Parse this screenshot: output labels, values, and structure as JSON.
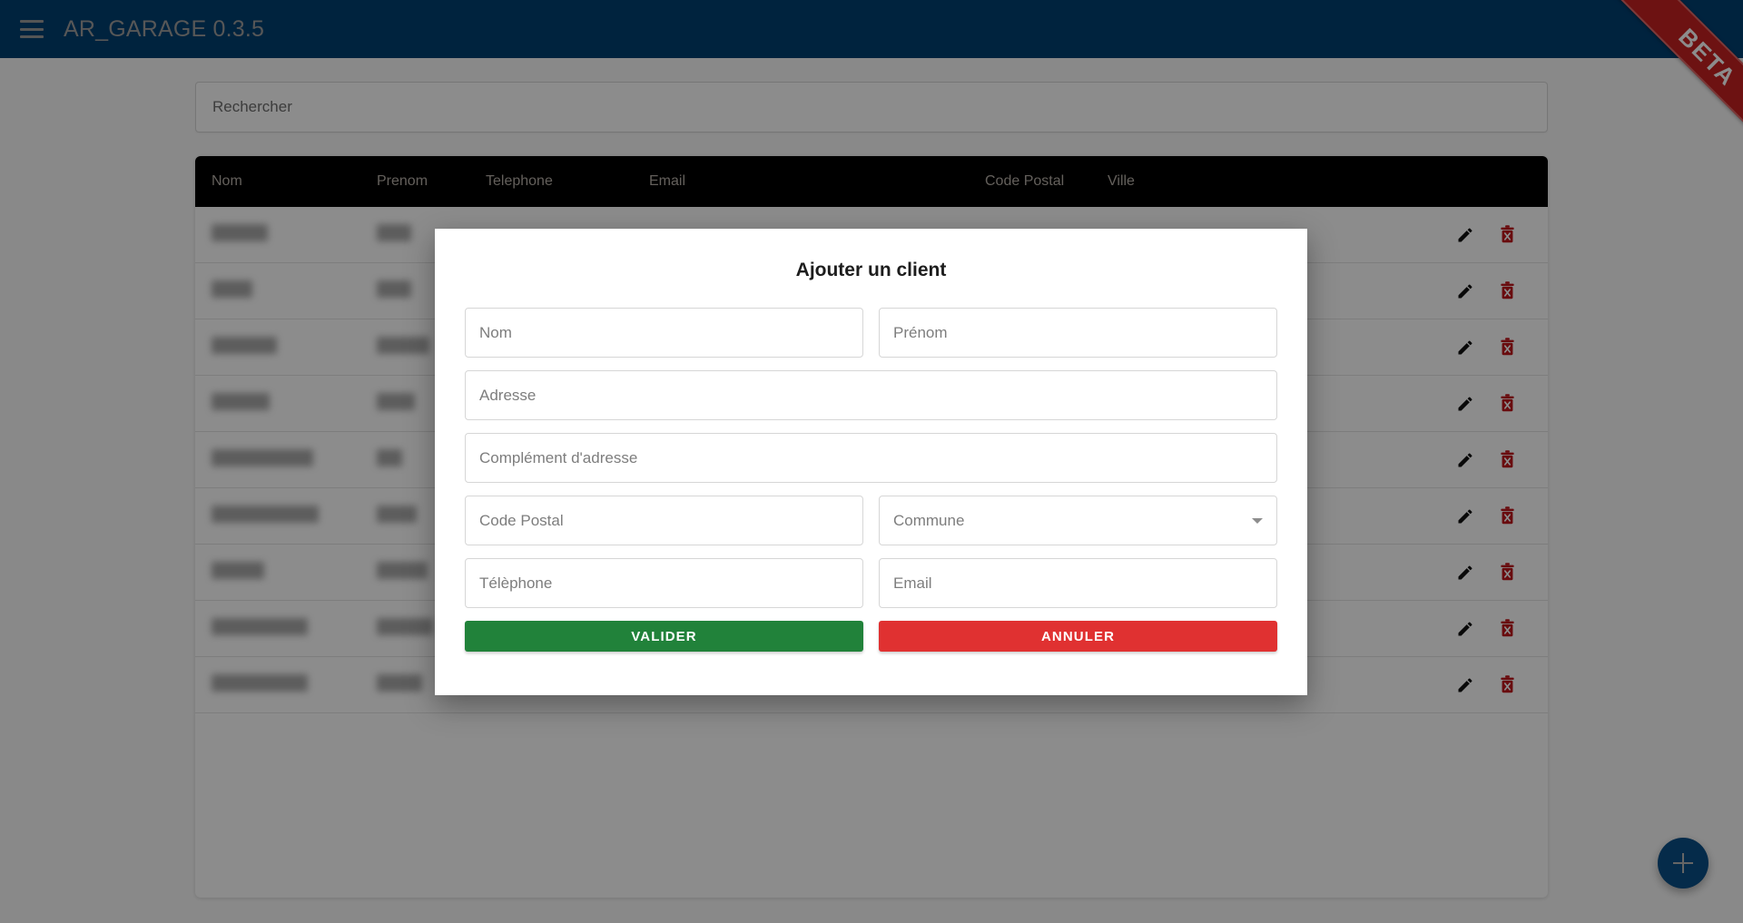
{
  "toolbar": {
    "menu_icon": "hamburger-menu-icon",
    "title": "AR_GARAGE 0.3.5",
    "bg_color": "#004072",
    "ribbon_label": "BETA",
    "ribbon_color": "#c62222"
  },
  "search": {
    "placeholder": "Rechercher",
    "value": ""
  },
  "table": {
    "columns": [
      "Nom",
      "Prenom",
      "Telephone",
      "Email",
      "",
      "Code Postal",
      "Ville"
    ],
    "header_bg": "#000000",
    "header_text_color": "#b7b0a8",
    "row_actions": {
      "edit_icon": "pencil-icon",
      "delete_icon": "trash-icon",
      "delete_color": "#c0161c"
    },
    "rows": [
      {
        "nom_w": 62,
        "prenom_w": 38,
        "tel_w": 0,
        "email_w": 0,
        "cp_w": 0,
        "ville_w": 0
      },
      {
        "nom_w": 45,
        "prenom_w": 38,
        "tel_w": 0,
        "email_w": 0,
        "cp_w": 0,
        "ville_w": 0
      },
      {
        "nom_w": 72,
        "prenom_w": 58,
        "tel_w": 0,
        "email_w": 0,
        "cp_w": 0,
        "ville_w": 0
      },
      {
        "nom_w": 64,
        "prenom_w": 42,
        "tel_w": 0,
        "email_w": 0,
        "cp_w": 0,
        "ville_w": 60
      },
      {
        "nom_w": 112,
        "prenom_w": 28,
        "tel_w": 0,
        "email_w": 0,
        "cp_w": 0,
        "ville_w": 0
      },
      {
        "nom_w": 118,
        "prenom_w": 44,
        "tel_w": 0,
        "email_w": 0,
        "cp_w": 0,
        "ville_w": 0
      },
      {
        "nom_w": 58,
        "prenom_w": 56,
        "tel_w": 0,
        "email_w": 0,
        "cp_w": 0,
        "ville_w": 0
      },
      {
        "nom_w": 106,
        "prenom_w": 62,
        "tel_w": 0,
        "email_w": 0,
        "cp_w": 0,
        "ville_w": 0
      },
      {
        "nom_w": 106,
        "prenom_w": 50,
        "tel_w": 0,
        "email_w": 0,
        "cp_w": 0,
        "ville_w": 0
      }
    ]
  },
  "fab": {
    "icon": "plus-icon",
    "color": "#0a4f87"
  },
  "modal": {
    "title": "Ajouter un client",
    "fields": {
      "nom": {
        "placeholder": "Nom",
        "value": ""
      },
      "prenom": {
        "placeholder": "Prénom",
        "value": ""
      },
      "adresse": {
        "placeholder": "Adresse",
        "value": ""
      },
      "complement": {
        "placeholder": "Complément d'adresse",
        "value": ""
      },
      "code_postal": {
        "placeholder": "Code Postal",
        "value": ""
      },
      "commune": {
        "placeholder": "Commune",
        "selected": "Commune",
        "caret_icon": "chevron-down-icon"
      },
      "telephone": {
        "placeholder": "Télèphone",
        "value": ""
      },
      "email": {
        "placeholder": "Email",
        "value": ""
      }
    },
    "buttons": {
      "validate": {
        "label": "VALIDER",
        "color": "#21823a"
      },
      "cancel": {
        "label": "ANNULER",
        "color": "#e03131"
      }
    }
  }
}
